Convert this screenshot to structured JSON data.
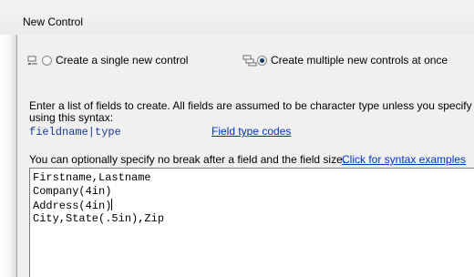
{
  "window": {
    "title": "New Control"
  },
  "options": {
    "single": {
      "label": "Create a single new control",
      "selected": false,
      "icon": "single-control-icon"
    },
    "multiple": {
      "label": "Create multiple new controls at once",
      "selected": true,
      "icon": "multiple-controls-icon"
    }
  },
  "instructions": {
    "line1": "Enter a list of fields to create. All fields are assumed to be character type unless you specify the type",
    "line2": "using this syntax:",
    "syntax": "fieldname|type",
    "field_type_link": "Field type codes",
    "nobreak_text": "You can optionally specify no break after a field and the field size.",
    "syntax_examples_link": "Click for syntax examples"
  },
  "fields_input": {
    "lines": [
      "Firstname,Lastname",
      "Company(4in)",
      "Address(4in)",
      "City,State(.5in),Zip"
    ]
  },
  "colors": {
    "link": "#0033cc",
    "syntax": "#1a3aa0",
    "background": "#f0f0f0"
  }
}
